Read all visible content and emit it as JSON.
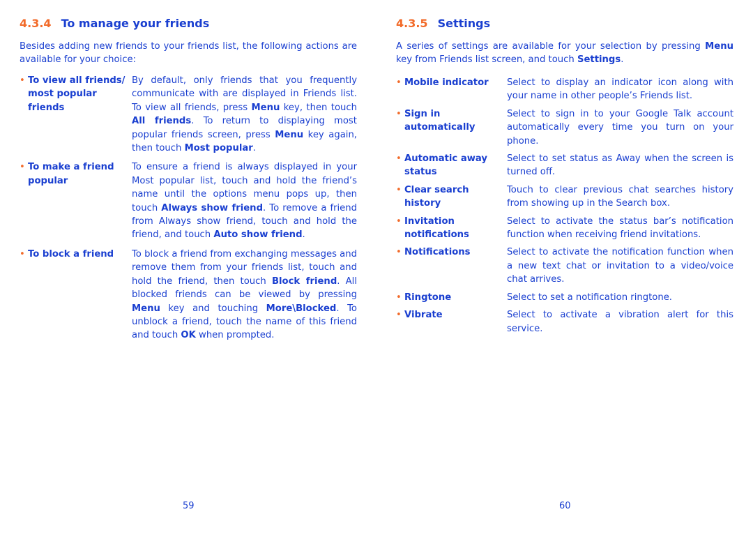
{
  "left_page": {
    "section_number": "4.3.4",
    "section_title": "To manage your friends",
    "intro": "Besides adding new friends to your friends list, the following actions are available for your choice:",
    "items": [
      {
        "term": "To view all friends/ most popular friends",
        "desc": [
          {
            "t": "By default, only friends that you frequently communicate with are displayed in Friends list. To view all friends, press "
          },
          {
            "b": "Menu"
          },
          {
            "t": " key, then touch "
          },
          {
            "b": "All friends"
          },
          {
            "t": ". To return to displaying most popular friends screen, press "
          },
          {
            "b": "Menu"
          },
          {
            "t": " key again, then touch "
          },
          {
            "b": "Most popular"
          },
          {
            "t": "."
          }
        ]
      },
      {
        "term": "To make a friend popular",
        "desc": [
          {
            "t": "To ensure a friend is always displayed in your Most popular list, touch and hold the friend’s name until the options menu pops up, then touch "
          },
          {
            "b": "Always show friend"
          },
          {
            "t": ". To remove a friend from Always show friend, touch and hold the friend, and touch "
          },
          {
            "b": "Auto show friend"
          },
          {
            "t": "."
          }
        ]
      },
      {
        "term": "To block a friend",
        "desc": [
          {
            "t": "To block a friend from exchanging messages and remove them from your friends list, touch and hold the friend, then touch "
          },
          {
            "b": "Block friend"
          },
          {
            "t": ". All blocked friends can be viewed by pressing "
          },
          {
            "b": "Menu"
          },
          {
            "t": " key and touching "
          },
          {
            "b": "More\\Blocked"
          },
          {
            "t": ". To unblock a friend, touch the name of this friend and touch "
          },
          {
            "b": "OK"
          },
          {
            "t": " when prompted."
          }
        ]
      }
    ],
    "page_number": "59"
  },
  "right_page": {
    "section_number": "4.3.5",
    "section_title": "Settings",
    "intro": [
      {
        "t": "A series of settings are available for your selection by pressing "
      },
      {
        "b": "Menu"
      },
      {
        "t": " key from Friends list screen, and touch "
      },
      {
        "b": "Settings"
      },
      {
        "t": "."
      }
    ],
    "items": [
      {
        "term": "Mobile indicator",
        "desc": [
          {
            "t": "Select to display an indicator icon along with your name in other people’s Friends list."
          }
        ]
      },
      {
        "term": "Sign in automatically",
        "desc": [
          {
            "t": "Select to sign in to your Google Talk account automatically every time you turn on your phone."
          }
        ]
      },
      {
        "term": "Automatic away status",
        "desc": [
          {
            "t": "Select to set status as Away when the screen is turned off."
          }
        ]
      },
      {
        "term": "Clear search history",
        "desc": [
          {
            "t": "Touch to clear previous chat searches history from showing up in the Search box."
          }
        ]
      },
      {
        "term": "Invitation notifications",
        "desc": [
          {
            "t": "Select to activate the status bar’s notification function when receiving friend invitations."
          }
        ]
      },
      {
        "term": "Notifications",
        "desc": [
          {
            "t": "Select to activate the notification function when a new text chat or invitation to a video/voice chat arrives."
          }
        ]
      },
      {
        "term": "Ringtone",
        "desc": [
          {
            "t": "Select to set a notification ringtone."
          }
        ]
      },
      {
        "term": "Vibrate",
        "desc": [
          {
            "t": "Select to activate a vibration alert for this service."
          }
        ]
      }
    ],
    "page_number": "60"
  },
  "colors": {
    "text_blue": "#1a3fd0",
    "accent_orange": "#f26b2a"
  },
  "bullet_glyph": "•"
}
